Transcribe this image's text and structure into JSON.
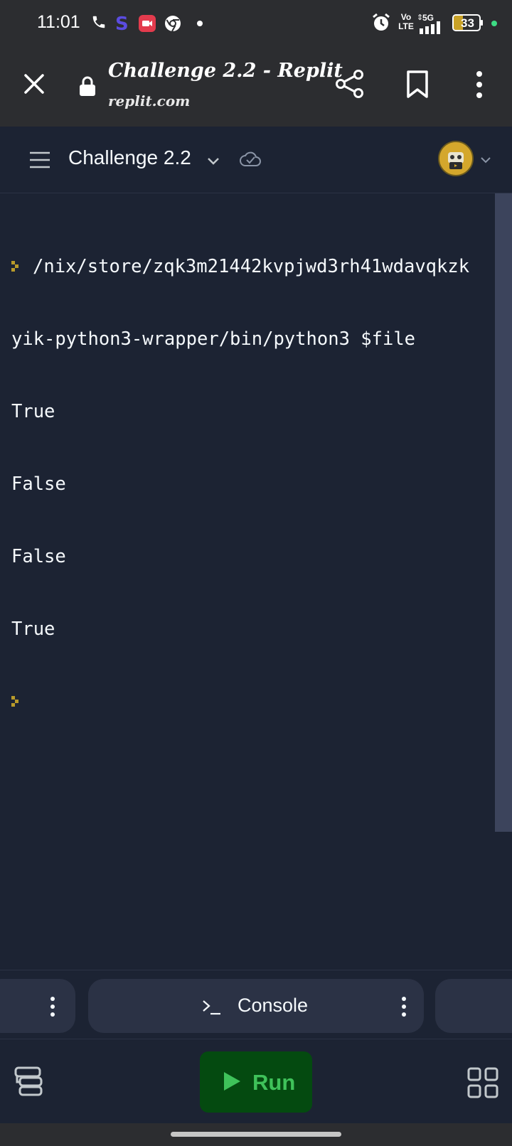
{
  "status_bar": {
    "time": "11:01",
    "network_label_top": "Vo",
    "network_label_bottom": "LTE",
    "signal_label": "5G",
    "battery": "33",
    "accent_green": "#3ddc84",
    "icons": [
      "phone-icon",
      "s-app-icon",
      "screen-record-icon",
      "chrome-icon",
      "dot-icon",
      "alarm-icon",
      "volte-icon",
      "signal-icon",
      "battery-icon"
    ]
  },
  "browser": {
    "title": "Challenge 2.2 - Replit",
    "url": "replit.com"
  },
  "repl": {
    "name": "Challenge 2.2"
  },
  "console": {
    "lines": [
      "/nix/store/zqk3m21442kvpjwd3rh41wdavqkzk",
      "yik-python3-wrapper/bin/python3 $file",
      "True",
      "False",
      "False",
      "True"
    ],
    "prompt_color": "#b89a2a"
  },
  "tabs": {
    "console_label": "Console"
  },
  "toolbar": {
    "run_label": "Run",
    "run_color": "#3fc25a",
    "run_bg": "#044a10"
  }
}
